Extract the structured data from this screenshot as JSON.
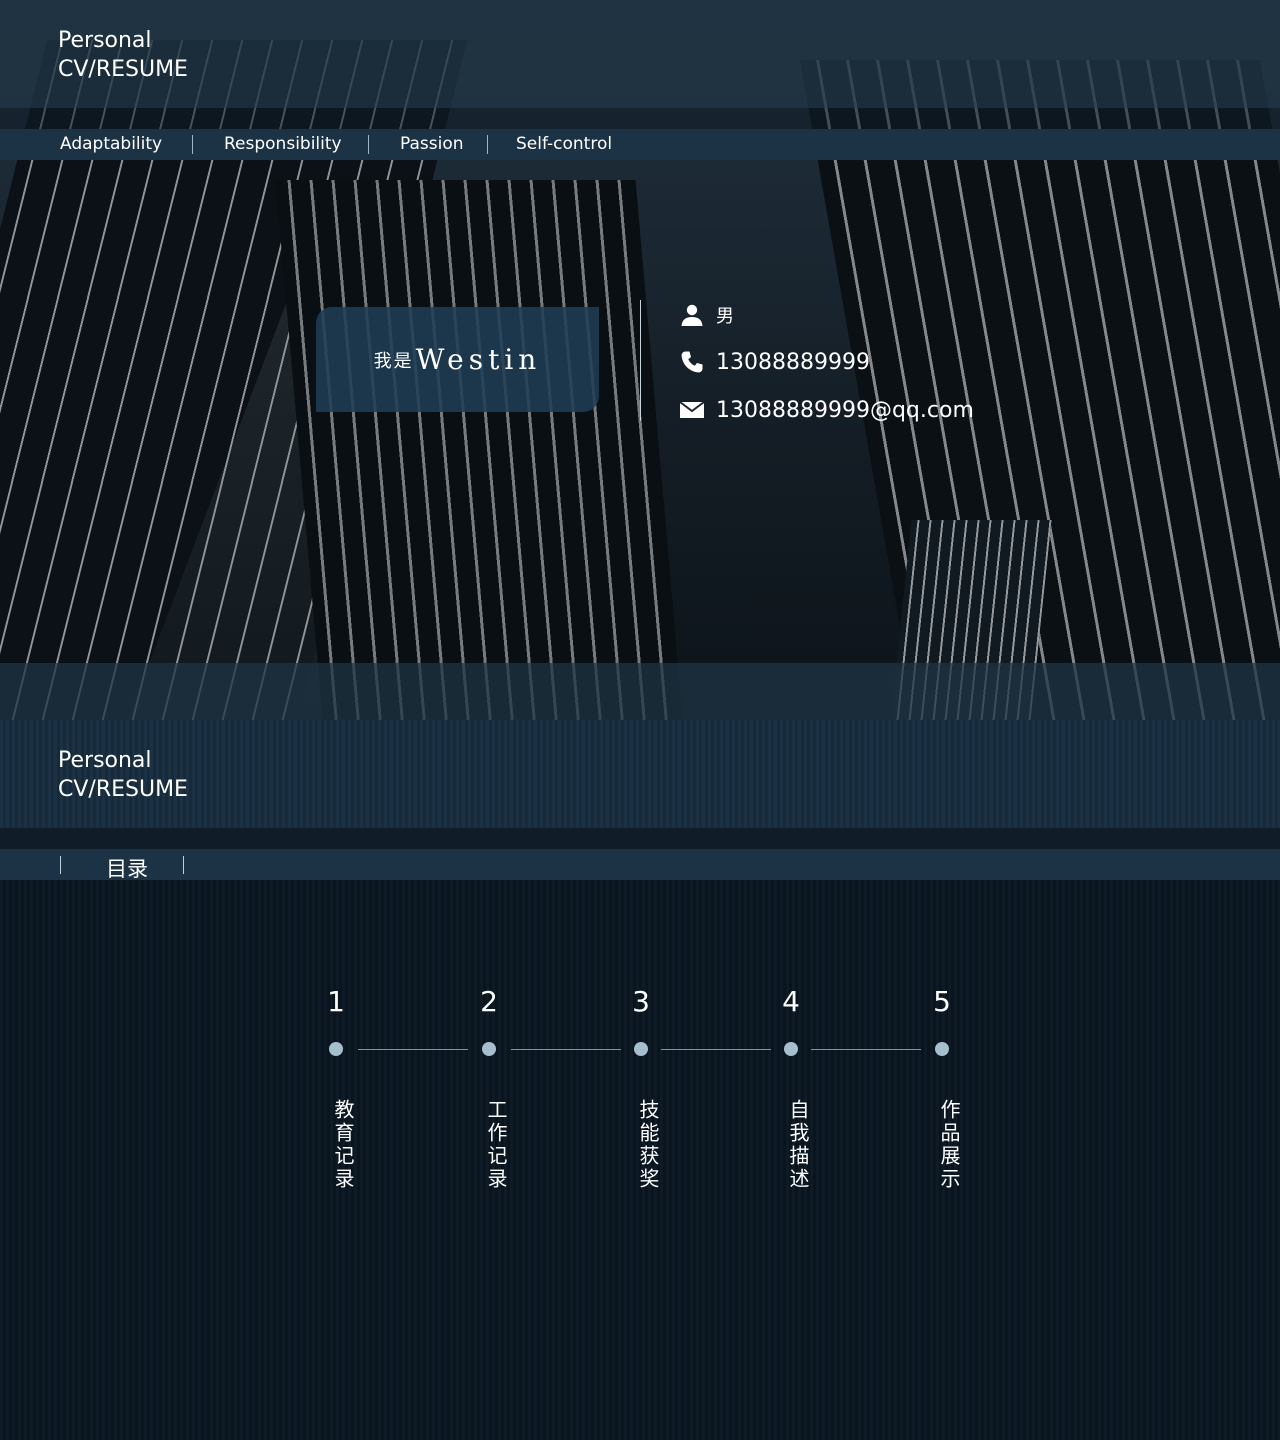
{
  "header": {
    "brand_line1": "Personal",
    "brand_line2": "CV/RESUME"
  },
  "nav": {
    "items": [
      "Adaptability",
      "Responsibility",
      "Passion",
      "Self-control"
    ]
  },
  "profile": {
    "name_prefix": "我是",
    "name": "Westin",
    "gender": "男",
    "phone": "13088889999",
    "email": "13088889999@qq.com"
  },
  "section2": {
    "brand_line1": "Personal",
    "brand_line2": "CV/RESUME",
    "toc_title": "目录",
    "steps": [
      {
        "num": "1",
        "label": "教育记录"
      },
      {
        "num": "2",
        "label": "工作记录"
      },
      {
        "num": "3",
        "label": "技能获奖"
      },
      {
        "num": "4",
        "label": "自我描述"
      },
      {
        "num": "5",
        "label": "作品展示"
      }
    ]
  },
  "icons": {
    "gender": "user-icon",
    "phone": "phone-icon",
    "email": "mail-icon"
  },
  "colors": {
    "navy": "#1c3346",
    "dot": "#a6bfcf"
  }
}
